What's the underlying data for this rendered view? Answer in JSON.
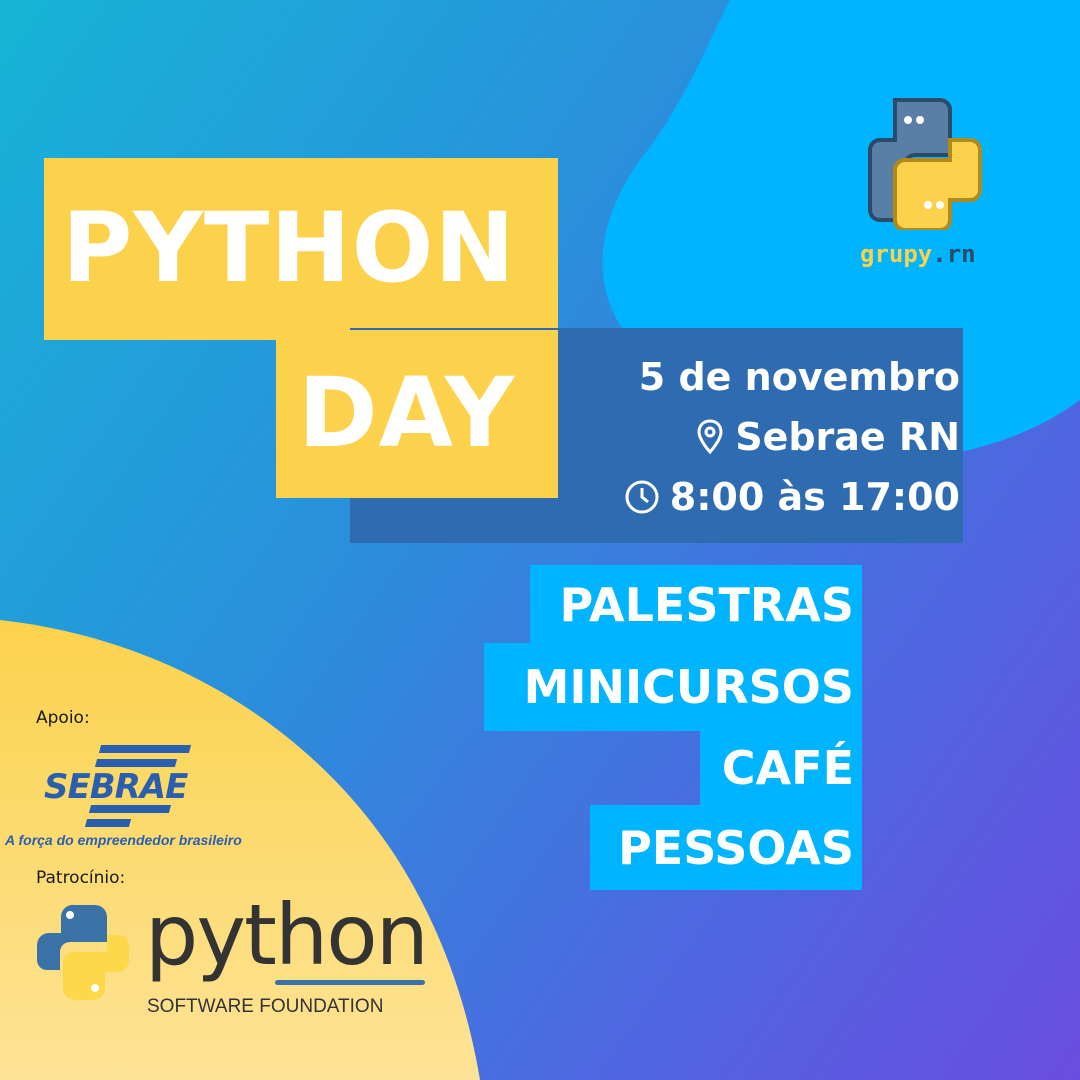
{
  "title": {
    "line1": "PYTHON",
    "line2": "DAY"
  },
  "details": {
    "date": "5 de novembro",
    "location": "Sebrae RN",
    "time": "8:00 às 17:00"
  },
  "activities": [
    "PALESTRAS",
    "MINICURSOS",
    "CAFÉ",
    "PESSOAS"
  ],
  "organizer": {
    "name_part1": "grupy",
    "name_part2": ".rn"
  },
  "support": {
    "label": "Apoio:",
    "logo": "SEBRAE",
    "tagline": "A força do empreendedor brasileiro"
  },
  "sponsor": {
    "label": "Patrocínio:",
    "logo": "python",
    "subtitle": "SOFTWARE FOUNDATION"
  },
  "colors": {
    "yellow": "#fcd24c",
    "cyan": "#00b4ff",
    "darkblue": "#2e6bb0"
  }
}
